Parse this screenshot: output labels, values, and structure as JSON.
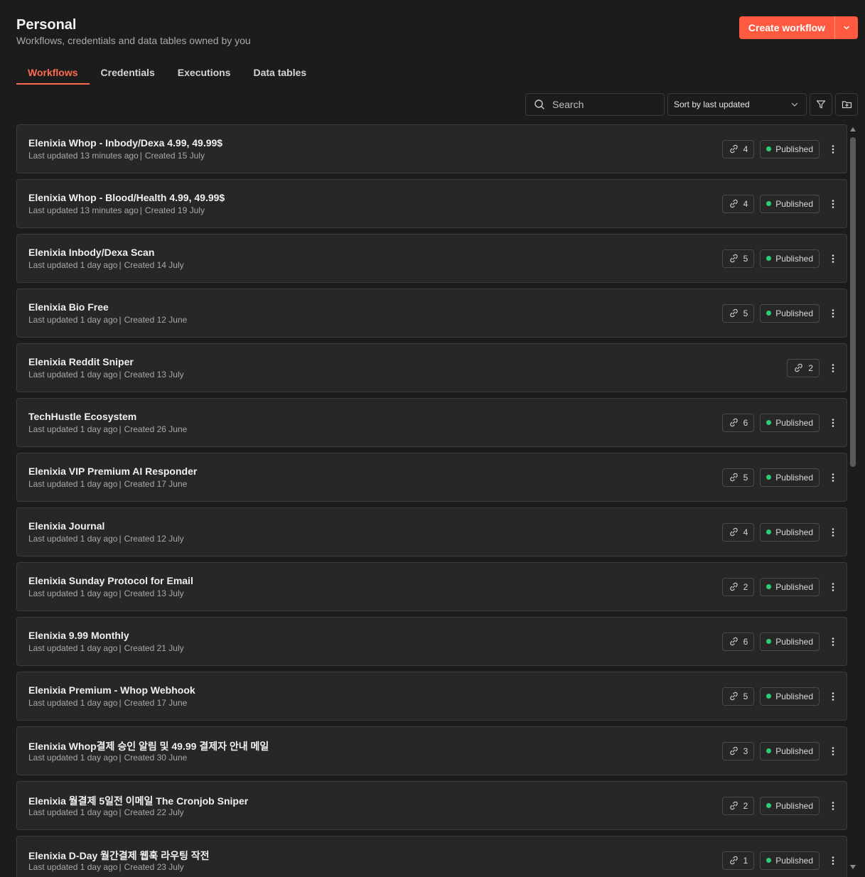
{
  "header": {
    "title": "Personal",
    "subtitle": "Workflows, credentials and data tables owned by you",
    "create_label": "Create workflow"
  },
  "tabs": [
    {
      "label": "Workflows",
      "active": true
    },
    {
      "label": "Credentials",
      "active": false
    },
    {
      "label": "Executions",
      "active": false
    },
    {
      "label": "Data tables",
      "active": false
    }
  ],
  "toolbar": {
    "search_placeholder": "Search",
    "sort_label": "Sort by last updated"
  },
  "colors": {
    "accent": "#ff5a3f",
    "published_dot": "#2ecc71",
    "background": "#1c1c1c",
    "card": "#272727"
  },
  "workflows": [
    {
      "name": "Elenixia Whop - Inbody/Dexa 4.99, 49.99$",
      "updated": "Last updated 13 minutes ago",
      "created": "Created 15 July",
      "links": "4",
      "status": "Published"
    },
    {
      "name": "Elenixia Whop - Blood/Health 4.99, 49.99$",
      "updated": "Last updated 13 minutes ago",
      "created": "Created 19 July",
      "links": "4",
      "status": "Published"
    },
    {
      "name": "Elenixia Inbody/Dexa Scan",
      "updated": "Last updated 1 day ago",
      "created": "Created 14 July",
      "links": "5",
      "status": "Published"
    },
    {
      "name": "Elenixia Bio Free",
      "updated": "Last updated 1 day ago",
      "created": "Created 12 June",
      "links": "5",
      "status": "Published"
    },
    {
      "name": "Elenixia Reddit Sniper",
      "updated": "Last updated 1 day ago",
      "created": "Created 13 July",
      "links": "2",
      "status": ""
    },
    {
      "name": "TechHustle Ecosystem",
      "updated": "Last updated 1 day ago",
      "created": "Created 26 June",
      "links": "6",
      "status": "Published"
    },
    {
      "name": "Elenixia VIP Premium AI Responder",
      "updated": "Last updated 1 day ago",
      "created": "Created 17 June",
      "links": "5",
      "status": "Published"
    },
    {
      "name": "Elenixia Journal",
      "updated": "Last updated 1 day ago",
      "created": "Created 12 July",
      "links": "4",
      "status": "Published"
    },
    {
      "name": "Elenixia Sunday Protocol for Email",
      "updated": "Last updated 1 day ago",
      "created": "Created 13 July",
      "links": "2",
      "status": "Published"
    },
    {
      "name": "Elenixia 9.99 Monthly",
      "updated": "Last updated 1 day ago",
      "created": "Created 21 July",
      "links": "6",
      "status": "Published"
    },
    {
      "name": "Elenixia Premium - Whop Webhook",
      "updated": "Last updated 1 day ago",
      "created": "Created 17 June",
      "links": "5",
      "status": "Published"
    },
    {
      "name": "Elenixia Whop결제 승인 알림 및 49.99 결제자 안내 메일",
      "updated": "Last updated 1 day ago",
      "created": "Created 30 June",
      "links": "3",
      "status": "Published"
    },
    {
      "name": "Elenixia 월결제 5일전 이메일 The Cronjob Sniper",
      "updated": "Last updated 1 day ago",
      "created": "Created 22 July",
      "links": "2",
      "status": "Published"
    },
    {
      "name": "Elenixia D-Day 월간결제 웹훅 라우팅 작전",
      "updated": "Last updated 1 day ago",
      "created": "Created 23 July",
      "links": "1",
      "status": "Published"
    }
  ]
}
